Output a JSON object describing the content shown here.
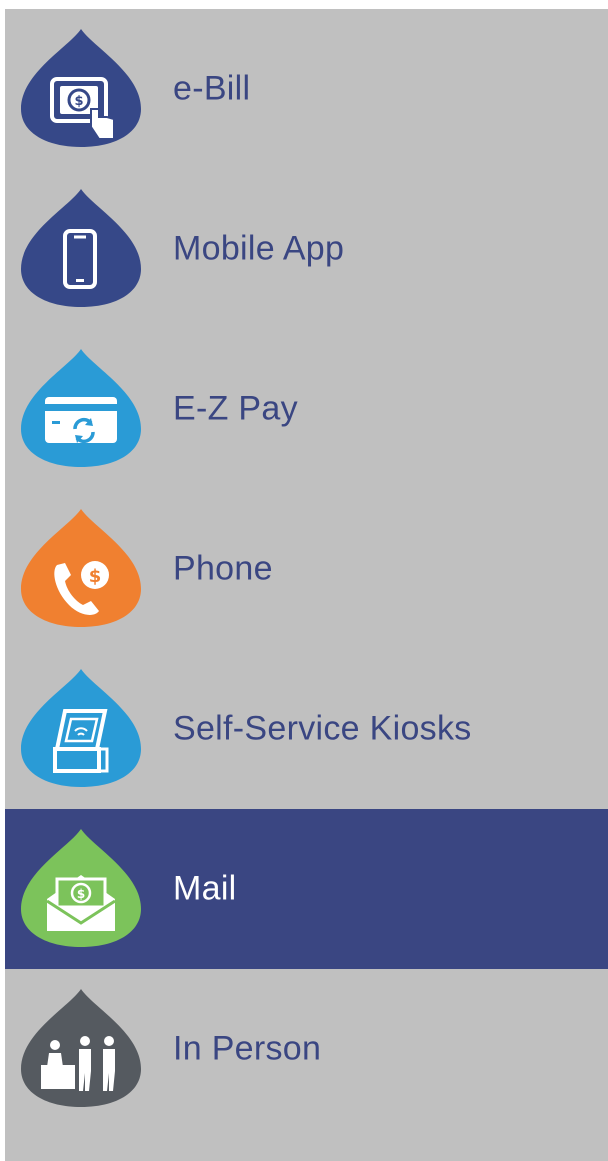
{
  "menu": {
    "items": [
      {
        "label": "e-Bill",
        "icon": "ebill-tablet-icon",
        "color": "#364888",
        "active": false
      },
      {
        "label": "Mobile App",
        "icon": "mobile-phone-icon",
        "color": "#364888",
        "active": false
      },
      {
        "label": "E-Z Pay",
        "icon": "card-autopay-icon",
        "color": "#2a9bd6",
        "active": false
      },
      {
        "label": "Phone",
        "icon": "phone-dollar-icon",
        "color": "#f08030",
        "active": false
      },
      {
        "label": "Self-Service Kiosks",
        "icon": "kiosk-icon",
        "color": "#2a9bd6",
        "active": false
      },
      {
        "label": "Mail",
        "icon": "mail-envelope-icon",
        "color": "#7cc35b",
        "active": true
      },
      {
        "label": "In Person",
        "icon": "in-person-icon",
        "color": "#555a60",
        "active": false
      }
    ],
    "active_background": "#3a4682",
    "background": "#c0c0c0"
  }
}
